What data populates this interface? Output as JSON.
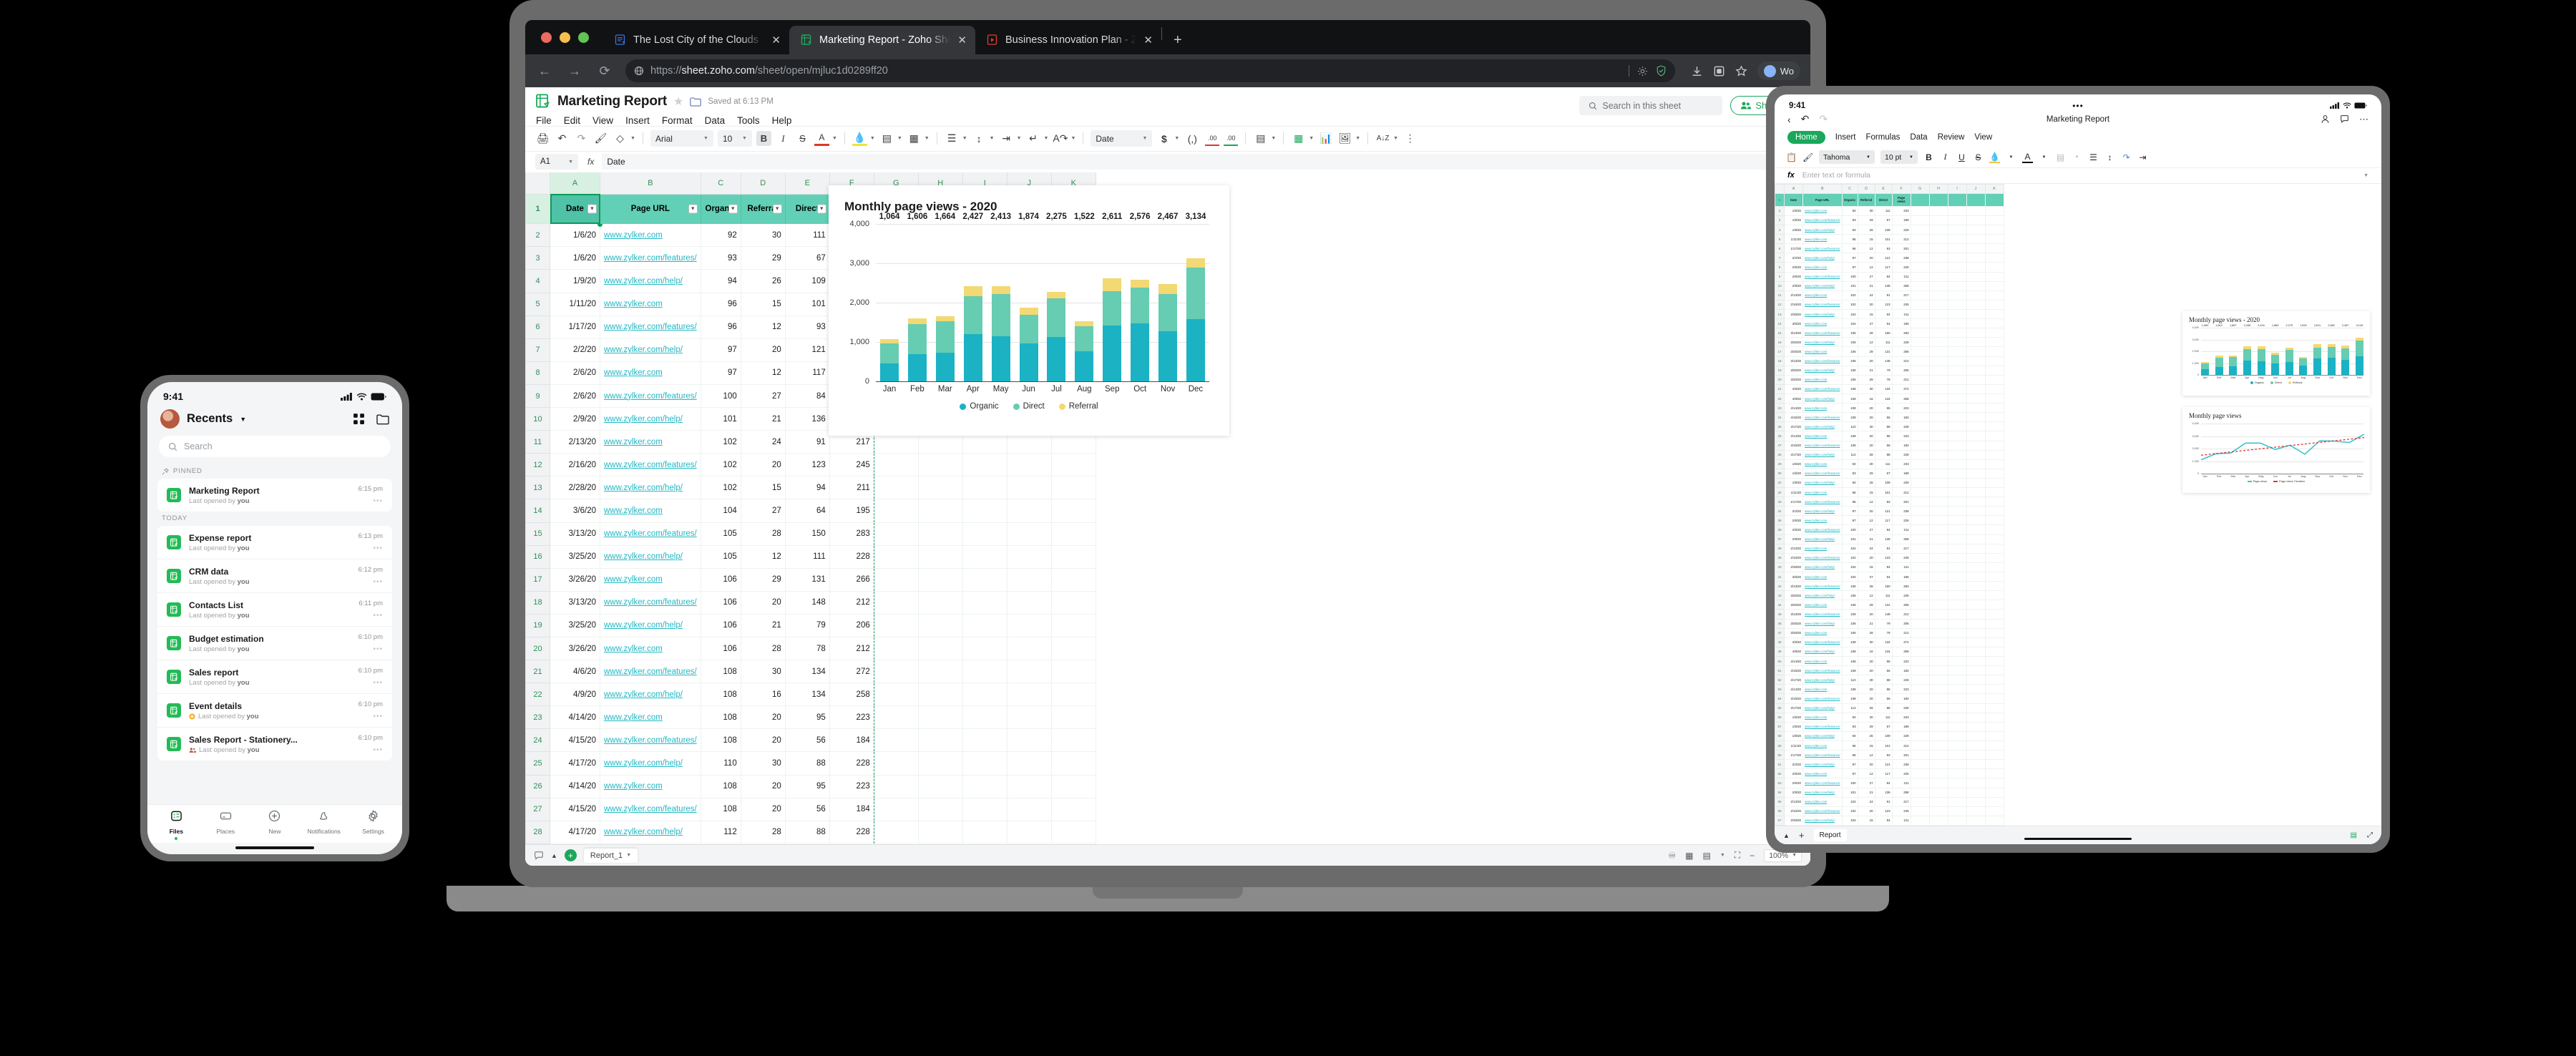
{
  "browser": {
    "tabs": [
      {
        "title": "The Lost City of the Clouds - Zo",
        "icon": "zoho-writer-icon",
        "active": false
      },
      {
        "title": "Marketing Report - Zoho Sheet",
        "icon": "zoho-sheet-icon",
        "active": true
      },
      {
        "title": "Business Innovation Plan - Zoh",
        "icon": "zoho-show-icon",
        "active": false
      }
    ],
    "new_tab_label": "+",
    "close_label": "✕",
    "url_scheme": "https://",
    "url_domain": "sheet.zoho.com",
    "url_path": "/sheet/open/mjluc1d0289ff20",
    "back_label": "←",
    "forward_label": "→",
    "reload_label": "⟳",
    "profile_label": "Wo"
  },
  "app": {
    "doc_title": "Marketing Report",
    "saved_status": "Saved at 6:13 PM",
    "menu": [
      "File",
      "Edit",
      "View",
      "Insert",
      "Format",
      "Data",
      "Tools",
      "Help"
    ],
    "search_placeholder": "Search in this sheet",
    "share_label": "Share",
    "toolbar": {
      "font_name": "Arial",
      "font_size": "10",
      "number_format": "Date",
      "bold": "B",
      "italic": "I",
      "strike": "S",
      "text_color": "A",
      "currency": "$",
      "comma": "(,)",
      "dec_less": ".00",
      "dec_more": ".00"
    },
    "formula_bar": {
      "name_box": "A1",
      "fx": "fx",
      "value": "Date"
    },
    "status_bar": {
      "sheet_tab": "Report_1",
      "zoom": "100%",
      "add_sheet": "+"
    }
  },
  "sheet": {
    "columns": [
      "A",
      "B",
      "C",
      "D",
      "E",
      "F",
      "G",
      "H",
      "I",
      "J",
      "K"
    ],
    "headers": [
      "Date",
      "Page URL",
      "Organic",
      "Referral",
      "Direct",
      "Page views"
    ],
    "rows": [
      [
        "1/6/20",
        "www.zylker.com",
        "92",
        "30",
        "111",
        "233"
      ],
      [
        "1/6/20",
        "www.zylker.com/features/",
        "93",
        "29",
        "67",
        "189"
      ],
      [
        "1/9/20",
        "www.zylker.com/help/",
        "94",
        "26",
        "109",
        "229"
      ],
      [
        "1/11/20",
        "www.zylker.com",
        "96",
        "15",
        "101",
        "212"
      ],
      [
        "1/17/20",
        "www.zylker.com/features/",
        "96",
        "12",
        "93",
        "201"
      ],
      [
        "2/2/20",
        "www.zylker.com/help/",
        "97",
        "20",
        "121",
        "238"
      ],
      [
        "2/6/20",
        "www.zylker.com",
        "97",
        "12",
        "117",
        "226"
      ],
      [
        "2/6/20",
        "www.zylker.com/features/",
        "100",
        "27",
        "84",
        "211"
      ],
      [
        "2/9/20",
        "www.zylker.com/help/",
        "101",
        "21",
        "136",
        "258"
      ],
      [
        "2/13/20",
        "www.zylker.com",
        "102",
        "24",
        "91",
        "217"
      ],
      [
        "2/16/20",
        "www.zylker.com/features/",
        "102",
        "20",
        "123",
        "245"
      ],
      [
        "2/28/20",
        "www.zylker.com/help/",
        "102",
        "15",
        "94",
        "211"
      ],
      [
        "3/6/20",
        "www.zylker.com",
        "104",
        "27",
        "64",
        "195"
      ],
      [
        "3/13/20",
        "www.zylker.com/features/",
        "105",
        "28",
        "150",
        "283"
      ],
      [
        "3/25/20",
        "www.zylker.com/help/",
        "105",
        "12",
        "111",
        "228"
      ],
      [
        "3/26/20",
        "www.zylker.com",
        "106",
        "29",
        "131",
        "266"
      ],
      [
        "3/13/20",
        "www.zylker.com/features/",
        "106",
        "20",
        "148",
        "212"
      ],
      [
        "3/25/20",
        "www.zylker.com/help/",
        "106",
        "21",
        "79",
        "206"
      ],
      [
        "3/26/20",
        "www.zylker.com",
        "106",
        "28",
        "78",
        "212"
      ],
      [
        "4/6/20",
        "www.zylker.com/features/",
        "108",
        "30",
        "134",
        "272"
      ],
      [
        "4/9/20",
        "www.zylker.com/help/",
        "108",
        "16",
        "134",
        "258"
      ],
      [
        "4/14/20",
        "www.zylker.com",
        "108",
        "20",
        "95",
        "223"
      ],
      [
        "4/15/20",
        "www.zylker.com/features/",
        "108",
        "20",
        "56",
        "184"
      ],
      [
        "4/17/20",
        "www.zylker.com/help/",
        "110",
        "30",
        "88",
        "228"
      ],
      [
        "4/14/20",
        "www.zylker.com",
        "108",
        "20",
        "95",
        "223"
      ],
      [
        "4/15/20",
        "www.zylker.com/features/",
        "108",
        "20",
        "56",
        "184"
      ],
      [
        "4/17/20",
        "www.zylker.com/help/",
        "112",
        "28",
        "88",
        "228"
      ]
    ]
  },
  "chart_data": {
    "type": "bar",
    "subtype": "stacked-bar",
    "title": "Monthly page views - 2020",
    "categories": [
      "Jan",
      "Feb",
      "Mar",
      "Apr",
      "May",
      "Jun",
      "Jul",
      "Aug",
      "Sep",
      "Oct",
      "Nov",
      "Dec"
    ],
    "series": [
      {
        "name": "Organic",
        "color": "#1bb2c4",
        "values": [
          460,
          690,
          730,
          1200,
          1140,
          965,
          1120,
          770,
          1425,
          1480,
          1270,
          1580
        ]
      },
      {
        "name": "Direct",
        "color": "#66ccb2",
        "values": [
          500,
          770,
          790,
          970,
          1070,
          730,
          985,
          630,
          875,
          900,
          950,
          1310
        ]
      },
      {
        "name": "Referral",
        "color": "#f2d974",
        "values": [
          104,
          146,
          144,
          257,
          203,
          179,
          170,
          122,
          311,
          196,
          247,
          244
        ]
      }
    ],
    "totals": [
      1064,
      1606,
      1664,
      2427,
      2413,
      1874,
      2275,
      1522,
      2611,
      2576,
      2467,
      3134
    ],
    "data_labels": [
      "1,064",
      "1,606",
      "1,664",
      "2,427",
      "2,413",
      "1,874",
      "2,275",
      "1,522",
      "2,611",
      "2,576",
      "2,467",
      "3,134"
    ],
    "ylabels": [
      "0",
      "1,000",
      "2,000",
      "3,000",
      "4,000"
    ],
    "ylim": [
      0,
      4000
    ],
    "xlabel": "",
    "ylabel": "",
    "grid": true,
    "legend_position": "bottom"
  },
  "phone": {
    "status_time": "9:41",
    "title": "Recents",
    "search_placeholder": "Search",
    "section_pinned": "PINNED",
    "section_today": "TODAY",
    "pinned": [
      {
        "name": "Marketing Report",
        "sub_prefix": "Last opened by",
        "sub_by": "you",
        "time": "6:15 pm",
        "badge": ""
      }
    ],
    "today": [
      {
        "name": "Expense report",
        "sub_prefix": "Last opened by",
        "sub_by": "you",
        "time": "6:13 pm",
        "badge": ""
      },
      {
        "name": "CRM data",
        "sub_prefix": "Last opened by",
        "sub_by": "you",
        "time": "6:12 pm",
        "badge": ""
      },
      {
        "name": "Contacts List",
        "sub_prefix": "Last opened by",
        "sub_by": "you",
        "time": "6:11 pm",
        "badge": ""
      },
      {
        "name": "Budget estimation",
        "sub_prefix": "Last opened by",
        "sub_by": "you",
        "time": "6:10 pm",
        "badge": ""
      },
      {
        "name": "Sales report",
        "sub_prefix": "Last opened by",
        "sub_by": "you",
        "time": "6:10 pm",
        "badge": ""
      },
      {
        "name": "Event details",
        "sub_prefix": "Last opened by",
        "sub_by": "you",
        "time": "6:10 pm",
        "badge": "star"
      },
      {
        "name": "Sales Report - Stationery...",
        "sub_prefix": "Last opened by",
        "sub_by": "you",
        "time": "6:10 pm",
        "badge": "shared"
      }
    ],
    "tabs": [
      {
        "label": "Files",
        "icon": "files-icon",
        "active": true
      },
      {
        "label": "Places",
        "icon": "places-icon",
        "active": false
      },
      {
        "label": "New",
        "icon": "plus-circle-icon",
        "active": false
      },
      {
        "label": "Notifications",
        "icon": "bell-icon",
        "active": false
      },
      {
        "label": "Settings",
        "icon": "gear-icon",
        "active": false
      }
    ],
    "more_label": "•••"
  },
  "tablet": {
    "status_time": "9:41",
    "doc_title": "Marketing Report",
    "overflow": "•••",
    "ribbon_tabs": [
      "Home",
      "Insert",
      "Formulas",
      "Data",
      "Review",
      "View"
    ],
    "active_ribbon_tab": "Home",
    "font_name": "Tahoma",
    "font_size": "10 pt",
    "bold": "B",
    "italic": "I",
    "underline": "U",
    "strike": "S",
    "fx": "fx",
    "formula_placeholder": "Enter text or formula",
    "columns": [
      "A",
      "B",
      "C",
      "D",
      "E",
      "F",
      "G",
      "H",
      "I",
      "J",
      "K"
    ],
    "headers": [
      "Date",
      "Page URL",
      "Organic",
      "Referral",
      "Direct",
      "Page views"
    ],
    "sheet_tab": "Report",
    "add_sheet": "+",
    "chart1": {
      "title": "Monthly page views - 2020",
      "categories": [
        "Jan",
        "Feb",
        "Mar",
        "Apr",
        "May",
        "Jun",
        "Jul",
        "Aug",
        "Sep",
        "Oct",
        "Nov",
        "Dec"
      ],
      "data_labels": [
        "1,064",
        "1,612",
        "1,667",
        "2,436",
        "2,416",
        "1,883",
        "2,275",
        "1,525",
        "2,611",
        "2,582",
        "2,467",
        "3,143"
      ],
      "totals": [
        1064,
        1612,
        1667,
        2436,
        2416,
        1883,
        2275,
        1525,
        2611,
        2582,
        2467,
        3143
      ],
      "series": [
        {
          "name": "Organic",
          "color": "#1bb2c4",
          "values": [
            460,
            690,
            730,
            1200,
            1140,
            965,
            1120,
            770,
            1425,
            1480,
            1270,
            1580
          ]
        },
        {
          "name": "Direct",
          "color": "#66ccb2",
          "values": [
            500,
            776,
            793,
            979,
            1073,
            739,
            985,
            633,
            875,
            906,
            950,
            1319
          ]
        },
        {
          "name": "Referral",
          "color": "#f2d974",
          "values": [
            104,
            146,
            144,
            257,
            203,
            179,
            170,
            122,
            311,
            196,
            247,
            244
          ]
        }
      ],
      "ylabels": [
        "0",
        "1,000",
        "2,000",
        "3,000",
        "4,000"
      ],
      "ylim": [
        0,
        4000
      ]
    },
    "chart2": {
      "type": "line",
      "title": "Monthly page views",
      "categories": [
        "Jan",
        "Feb",
        "Mar",
        "Apr",
        "May",
        "Jun",
        "Jul",
        "Aug",
        "Sep",
        "Oct",
        "Nov",
        "Dec"
      ],
      "values": [
        1100,
        1590,
        1640,
        2440,
        2440,
        1930,
        2270,
        1550,
        2620,
        2600,
        2480,
        3150
      ],
      "trend": [
        1470,
        1600,
        1730,
        1855,
        1985,
        2110,
        2240,
        2365,
        2495,
        2620,
        2750,
        2875
      ],
      "line_color": "#3ec3cf",
      "trend_color": "#e0362c",
      "ylabels": [
        "0",
        "1,000",
        "2,000",
        "3,000",
        "4,000"
      ],
      "ylim": [
        0,
        4000
      ],
      "legend": [
        "Page views",
        "Page views Trendline"
      ]
    }
  }
}
